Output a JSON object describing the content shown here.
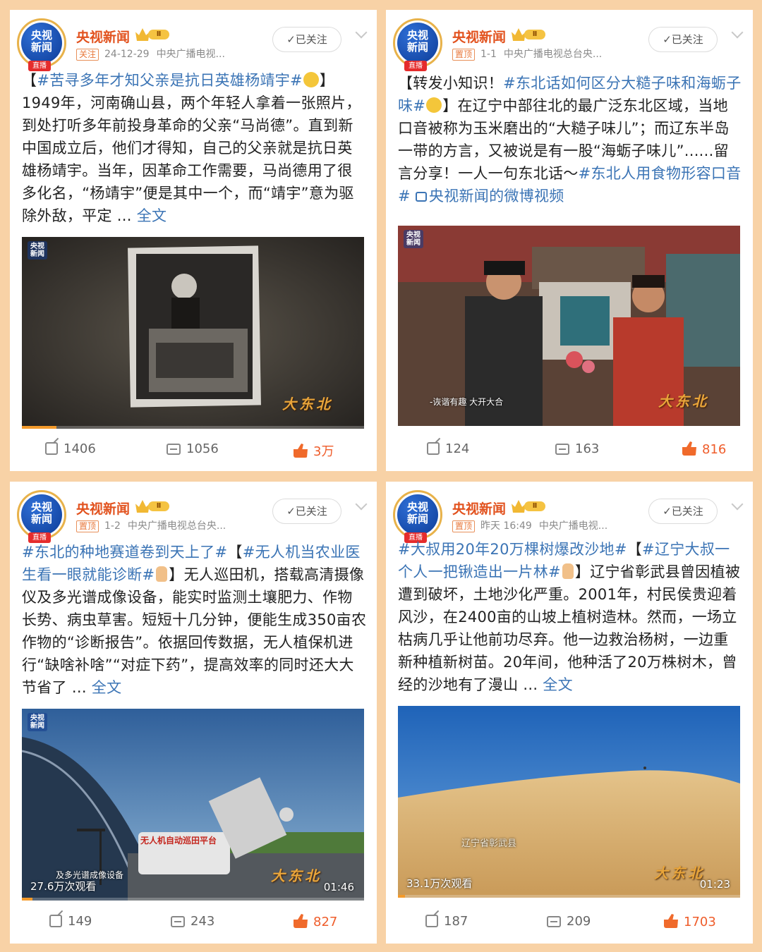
{
  "posts": [
    {
      "account_name": "央视新闻",
      "avatar_line1": "央视",
      "avatar_line2": "新闻",
      "avatar_tag": "直播",
      "vip_level": "Ⅱ",
      "meta_tag": "关注",
      "date": "24-12-29",
      "source": "中央广播电视...",
      "follow_label": "✓已关注",
      "text_parts": [
        {
          "t": "【",
          "k": "plain"
        },
        {
          "t": "#苦寻多年才知父亲是抗日英雄杨靖宇#",
          "k": "hash"
        },
        {
          "t": "",
          "k": "emoji"
        },
        {
          "t": "】1949年，河南确山县，两个年轻人拿着一张照片，到处打听多年前投身革命的父亲“马尚德”。直到新中国成立后，他们才得知，自己的父亲就是抗日英雄杨靖宇。当年，因革命工作需要，马尚德用了很多化名，“杨靖宇”便是其中一个，而“靖宇”意为驱除外敌，平定 ... ",
          "k": "plain"
        },
        {
          "t": "全文",
          "k": "more"
        }
      ],
      "media": {
        "logo_line1": "央视",
        "logo_line2": "新闻",
        "watermark": "大东北",
        "views": "",
        "duration": "",
        "subtitle": "",
        "progress": 0.1
      },
      "reposts": "1406",
      "comments": "1056",
      "likes": "3万"
    },
    {
      "account_name": "央视新闻",
      "avatar_line1": "央视",
      "avatar_line2": "新闻",
      "avatar_tag": "直播",
      "vip_level": "Ⅱ",
      "meta_tag": "置顶",
      "date": "1-1",
      "source": "中央广播电视总台央...",
      "follow_label": "✓已关注",
      "text_parts": [
        {
          "t": "【转发小知识！",
          "k": "plain"
        },
        {
          "t": "#东北话如何区分大糙子味和海蛎子味#",
          "k": "hash"
        },
        {
          "t": "",
          "k": "emoji"
        },
        {
          "t": "】在辽宁中部往北的最广泛东北区域，当地口音被称为玉米磨出的“大糙子味儿”；而辽东半岛一带的方言，又被说是有一股“海蛎子味儿”......留言分享！一人一句东北话～",
          "k": "plain"
        },
        {
          "t": "#东北人用食物形容口音#",
          "k": "hash"
        },
        {
          "t": " ",
          "k": "plain"
        },
        {
          "t": "",
          "k": "video"
        },
        {
          "t": "央视新闻的微博视频",
          "k": "hash"
        }
      ],
      "media": {
        "logo_line1": "央视",
        "logo_line2": "新闻",
        "watermark": "大东北",
        "views": "",
        "duration": "",
        "subtitle": "-诙谐有趣 大开大合",
        "progress": 0
      },
      "reposts": "124",
      "comments": "163",
      "likes": "816"
    },
    {
      "account_name": "央视新闻",
      "avatar_line1": "央视",
      "avatar_line2": "新闻",
      "avatar_tag": "直播",
      "vip_level": "Ⅱ",
      "meta_tag": "置顶",
      "date": "1-2",
      "source": "中央广播电视总台央...",
      "follow_label": "✓已关注",
      "text_parts": [
        {
          "t": "#东北的种地赛道卷到天上了#",
          "k": "hash"
        },
        {
          "t": "【",
          "k": "plain"
        },
        {
          "t": "#无人机当农业医生看一眼就能诊断#",
          "k": "hash"
        },
        {
          "t": "",
          "k": "hand"
        },
        {
          "t": "】无人巡田机，搭载高清摄像仪及多光谱成像设备，能实时监测土壤肥力、作物长势、病虫草害。短短十几分钟，便能生成350亩农作物的“诊断报告”。依据回传数据，无人植保机进行“缺啥补啥”“对症下药”，提高效率的同时还大大节省了 ... ",
          "k": "plain"
        },
        {
          "t": "全文",
          "k": "more"
        }
      ],
      "media": {
        "logo_line1": "央视",
        "logo_line2": "新闻",
        "watermark": "大东北",
        "views": "27.6万次观看",
        "duration": "01:46",
        "subtitle": "及多光谱成像设备",
        "sign": "无人机自动巡田平台",
        "progress": 0.03
      },
      "reposts": "149",
      "comments": "243",
      "likes": "827"
    },
    {
      "account_name": "央视新闻",
      "avatar_line1": "央视",
      "avatar_line2": "新闻",
      "avatar_tag": "直播",
      "vip_level": "Ⅱ",
      "meta_tag": "置顶",
      "date": "昨天 16:49",
      "source": "中央广播电视...",
      "follow_label": "✓已关注",
      "text_parts": [
        {
          "t": "#大叔用20年20万棵树爆改沙地#",
          "k": "hash"
        },
        {
          "t": "【",
          "k": "plain"
        },
        {
          "t": "#辽宁大叔一个人一把锹造出一片林#",
          "k": "hash"
        },
        {
          "t": "",
          "k": "hand"
        },
        {
          "t": "】辽宁省彰武县曾因植被遭到破坏，土地沙化严重。2001年，村民侯贵迎着风沙，在2400亩的山坡上植树造林。然而，一场立枯病几乎让他前功尽弃。他一边救治杨树，一边重新种植新树苗。20年间，他种活了20万株树木，曾经的沙地有了漫山 ... ",
          "k": "plain"
        },
        {
          "t": "全文",
          "k": "more"
        }
      ],
      "media": {
        "logo_line1": "",
        "logo_line2": "",
        "watermark": "大东北",
        "views": "33.1万次观看",
        "duration": "01:23",
        "subtitle": "",
        "place": "辽宁省彰武县",
        "progress": 0.02
      },
      "reposts": "187",
      "comments": "209",
      "likes": "1703"
    }
  ]
}
